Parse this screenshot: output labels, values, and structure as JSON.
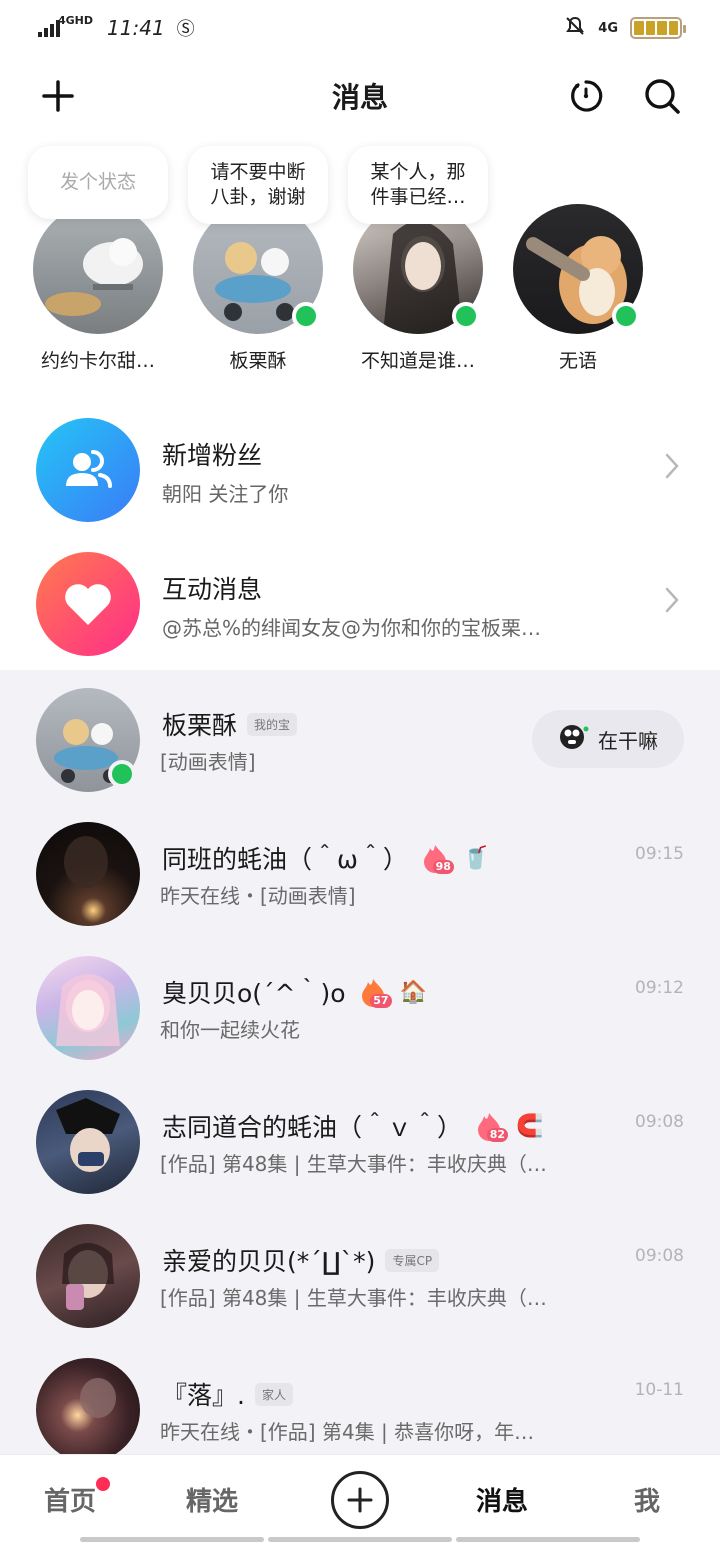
{
  "status_bar": {
    "network": "4GHD",
    "time": "11:41",
    "right_network": "4G",
    "battery": "battery-icon"
  },
  "header": {
    "title": "消息",
    "add_icon": "plus-icon",
    "refresh_icon": "refresh-icon",
    "search_icon": "search-icon"
  },
  "stories": [
    {
      "bubble": "发个状态",
      "name": "约约卡尔甜…",
      "online": false,
      "placeholder": true
    },
    {
      "bubble": "请不要中断八卦，谢谢",
      "name": "板栗酥",
      "online": true,
      "placeholder": false
    },
    {
      "bubble": "某个人，那件事已经…",
      "name": "不知道是谁…",
      "online": true,
      "placeholder": false
    },
    {
      "bubble": "",
      "name": "无语",
      "online": true,
      "placeholder": false
    }
  ],
  "notifications": [
    {
      "title": "新增粉丝",
      "subtitle": "朝阳 关注了你",
      "icon": "fans-icon",
      "color_from": "#25c6f5",
      "color_to": "#3a7bf7"
    },
    {
      "title": "互动消息",
      "subtitle": "@苏总%的绯闻女友@为你和你的宝板栗…",
      "icon": "heart-icon",
      "color_from": "#ff5a6e",
      "color_to": "#ff2d8a"
    }
  ],
  "chats": [
    {
      "name": "板栗酥",
      "tag": "我的宝",
      "preview": "[动画表情]",
      "time": "",
      "online": true,
      "action": "在干嘛",
      "flame": "",
      "badge": ""
    },
    {
      "name": "同班的蚝油（＾ω＾）",
      "tag": "",
      "preview": "昨天在线・[动画表情]",
      "time": "09:15",
      "online": false,
      "action": "",
      "flame": "98",
      "badge": "🥤"
    },
    {
      "name": "臭贝贝o(´^｀)o",
      "tag": "",
      "preview": "和你一起续火花",
      "time": "09:12",
      "online": false,
      "action": "",
      "flame": "57",
      "badge": "🏠"
    },
    {
      "name": "志同道合的蚝油（＾ｖ＾）",
      "tag": "",
      "preview": "[作品] 第48集 | 生草大事件：丰收庆典（…",
      "time": "09:08",
      "online": false,
      "action": "",
      "flame": "82",
      "badge": "🧲"
    },
    {
      "name": "亲爱的贝贝(*´∐`*)",
      "tag": "专属CP",
      "preview": "[作品] 第48集 | 生草大事件：丰收庆典（…",
      "time": "09:08",
      "online": false,
      "action": "",
      "flame": "",
      "badge": ""
    },
    {
      "name": "『落』.",
      "tag": "家人",
      "preview": "昨天在线・[作品] 第4集 | 恭喜你呀，年…",
      "time": "10-11",
      "online": false,
      "action": "",
      "flame": "",
      "badge": ""
    }
  ],
  "bottom_nav": {
    "home": "首页",
    "featured": "精选",
    "add": "plus-circle-icon",
    "messages": "消息",
    "me": "我"
  },
  "colors": {
    "online": "#22c25a",
    "chat_bg": "#f3f3f7",
    "red_dot": "#ff2c55"
  }
}
